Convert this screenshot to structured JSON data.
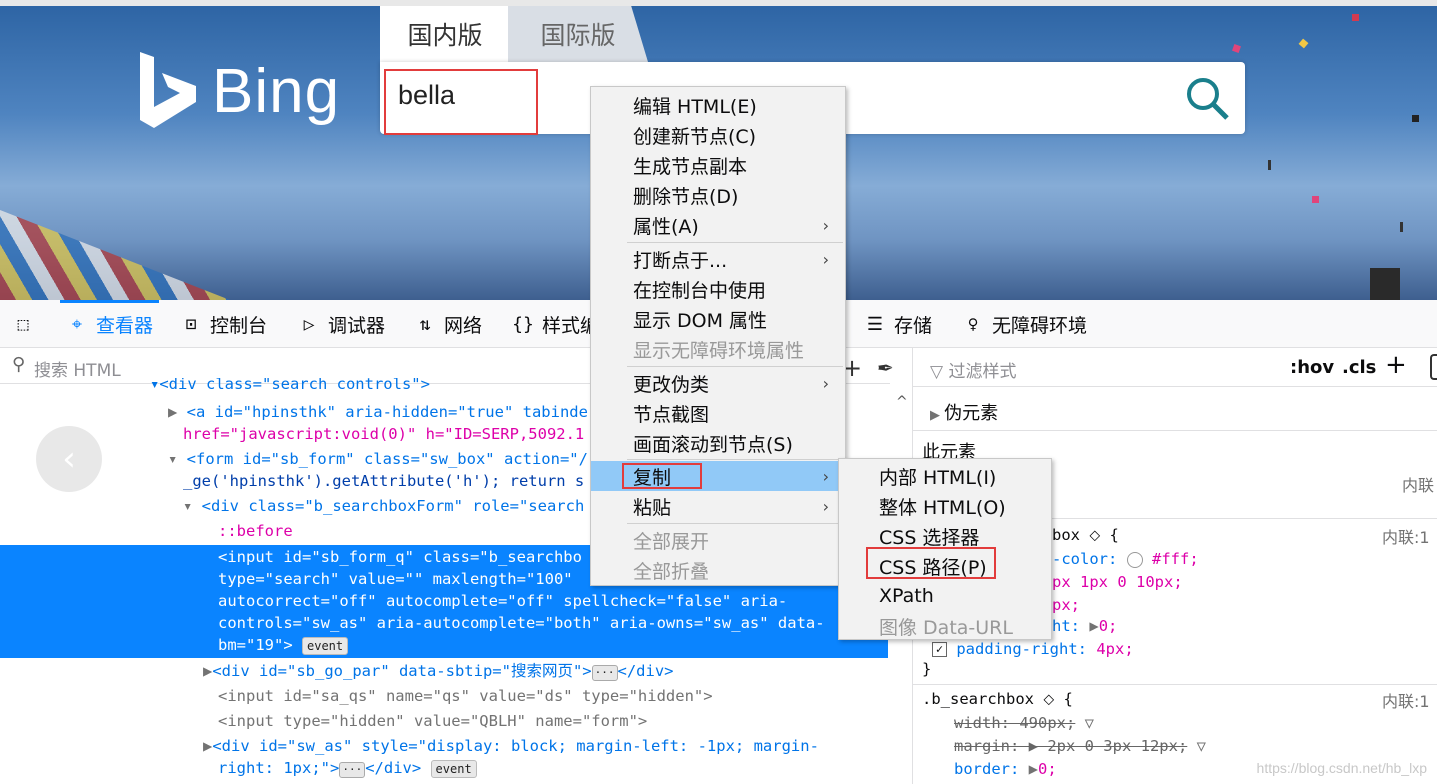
{
  "bing": {
    "logo": "Bing",
    "scope_active": "国内版",
    "scope_inactive": "国际版",
    "query": "bella"
  },
  "toolbar": {
    "tabs": [
      {
        "icon": "cursor-pick-icon",
        "label": ""
      },
      {
        "icon": "inspector-icon",
        "label": "查看器"
      },
      {
        "icon": "console-icon",
        "label": "控制台"
      },
      {
        "icon": "debugger-icon",
        "label": "调试器"
      },
      {
        "icon": "network-icon",
        "label": "网络"
      },
      {
        "icon": "style-editor-icon",
        "label": "样式编"
      },
      {
        "icon": "storage-icon",
        "label": "存储"
      },
      {
        "icon": "accessibility-icon",
        "label": "无障碍环境"
      }
    ]
  },
  "inspector": {
    "search_placeholder": "搜索 HTML"
  },
  "rules": {
    "filter_placeholder": "过滤样式",
    "hov": ":hov",
    "cls": ".cls",
    "pseudo": "伪元素",
    "this_element": "此元素",
    "inline": "内联",
    "inline1": "内联:1",
    "inline2": "内联:1"
  },
  "context_menu": {
    "items": [
      {
        "label": "编辑 HTML(E)"
      },
      {
        "label": "创建新节点(C)"
      },
      {
        "label": "生成节点副本"
      },
      {
        "label": "删除节点(D)"
      },
      {
        "label": "属性(A)"
      },
      {
        "label": "打断点于..."
      },
      {
        "label": "在控制台中使用"
      },
      {
        "label": "显示 DOM 属性"
      },
      {
        "label": "显示无障碍环境属性"
      },
      {
        "label": "更改伪类"
      },
      {
        "label": "节点截图"
      },
      {
        "label": "画面滚动到节点(S)"
      },
      {
        "label": "复制"
      },
      {
        "label": "粘贴"
      },
      {
        "label": "全部展开"
      },
      {
        "label": "全部折叠"
      }
    ]
  },
  "copy_submenu": {
    "items": [
      {
        "label": "内部 HTML(I)"
      },
      {
        "label": "整体 HTML(O)"
      },
      {
        "label": "CSS 选择器"
      },
      {
        "label": "CSS 路径(P)"
      },
      {
        "label": "XPath"
      },
      {
        "label": "图像 Data-URL"
      }
    ]
  },
  "code": {
    "l0": "▾<div class=\"search_controls\">",
    "l1a": "<a id=\"hpinsthk\" aria-hidden=\"true\" tabinde",
    "l1b": "href=\"javascript:void(0)\" h=\"ID=SERP,5092.1",
    "l2a": "<form id=\"sb_form\" class=\"sw_box\" action=\"/",
    "l2b": "_ge('hpinsthk').getAttribute('h'); return s",
    "l3": "<div class=\"b_searchboxForm\" role=\"search",
    "l4": "::before",
    "s1": "<input id=\"sb_form_q\" class=\"b_searchbo",
    "s2": "type=\"search\" value=\"\" maxlength=\"100\"",
    "s3": "autocorrect=\"off\" autocomplete=\"off\" spellcheck=\"false\" aria-",
    "s4": "controls=\"sw_as\" aria-autocomplete=\"both\" aria-owns=\"sw_as\" data-",
    "s5": "bm=\"19\">",
    "event": "event",
    "l5": "<div id=\"sb_go_par\" data-sbtip=\"搜索网页\">",
    "l5end": "</div>",
    "l6": "<input id=\"sa_qs\" name=\"qs\" value=\"ds\" type=\"hidden\">",
    "l7": "<input type=\"hidden\" value=\"QBLH\" name=\"form\">",
    "l8a": "<div id=\"sw_as\" style=\"display: block; margin-left: -1px; margin-",
    "l8b": "right: 1px;\">",
    "l8end": "</div>"
  },
  "css_rules": {
    "r1_sel": "box",
    "r1_l1": "-color:",
    "r1_l1v": "#fff;",
    "r1_l2": "px 1px 0 10px;",
    "r1_l3": "px;",
    "r1_l4": "ht:",
    "r1_l4v": "0;",
    "r1_l5p": "padding-right:",
    "r1_l5v": "4px;",
    "close": "}",
    "r2_sel": ".b_searchbox",
    "r2_l1": "width: 490px;",
    "r2_l2": "margin: ▶ 2px 0 3px 12px;",
    "r2_l3p": "border:",
    "r2_l3v": "0;"
  },
  "watermark": "https://blog.csdn.net/hb_lxp"
}
